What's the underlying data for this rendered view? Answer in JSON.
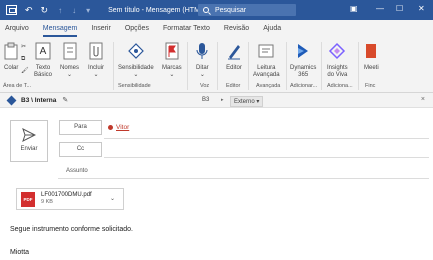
{
  "titlebar": {
    "title": "Sem título - Mensagem (HTML)",
    "search_placeholder": "Pesquisar"
  },
  "menu": {
    "tabs": [
      "Arquivo",
      "Mensagem",
      "Inserir",
      "Opções",
      "Formatar Texto",
      "Revisão",
      "Ajuda"
    ],
    "active": "Mensagem"
  },
  "ribbon": {
    "items": {
      "paste": "Colar",
      "text": "Texto",
      "text2": "Básico",
      "names": "Nomes",
      "include": "Incluir",
      "sensitivity": "Sensibilidade",
      "tags": "Marcas",
      "dictate": "Ditar",
      "editor": "Editor",
      "reading1": "Leitura",
      "reading2": "Avançada",
      "dynamics1": "Dynamics",
      "dynamics2": "365",
      "insights1": "Insights",
      "insights2": "do Viva",
      "meeting": "Meeti"
    },
    "groups": {
      "clipboard": "Área de T...",
      "sensitivity": "Sensibilidade",
      "voice": "Voz",
      "editor": "Editor",
      "advanced": "Avançada",
      "add": "Adicionar...",
      "add2": "Adiciona...",
      "finc": "Finc"
    }
  },
  "sensitivity_bar": {
    "label": "B3 \\ Interna",
    "code": "B3",
    "external": "Externo"
  },
  "compose": {
    "send": "Enviar",
    "to_label": "Para",
    "to_value": "Vitor",
    "cc_label": "Cc",
    "subject_label": "Assunto"
  },
  "attachment": {
    "name": "LF001700DMU.pdf",
    "size": "9 KB",
    "type_label": "PDF"
  },
  "body": {
    "line1": "Segue instrumento conforme solicitado.",
    "line2": "Miotta"
  },
  "colors": {
    "brand": "#2b579a",
    "ribbon_bg": "#f3f3f3",
    "alert_red": "#c0392b"
  }
}
